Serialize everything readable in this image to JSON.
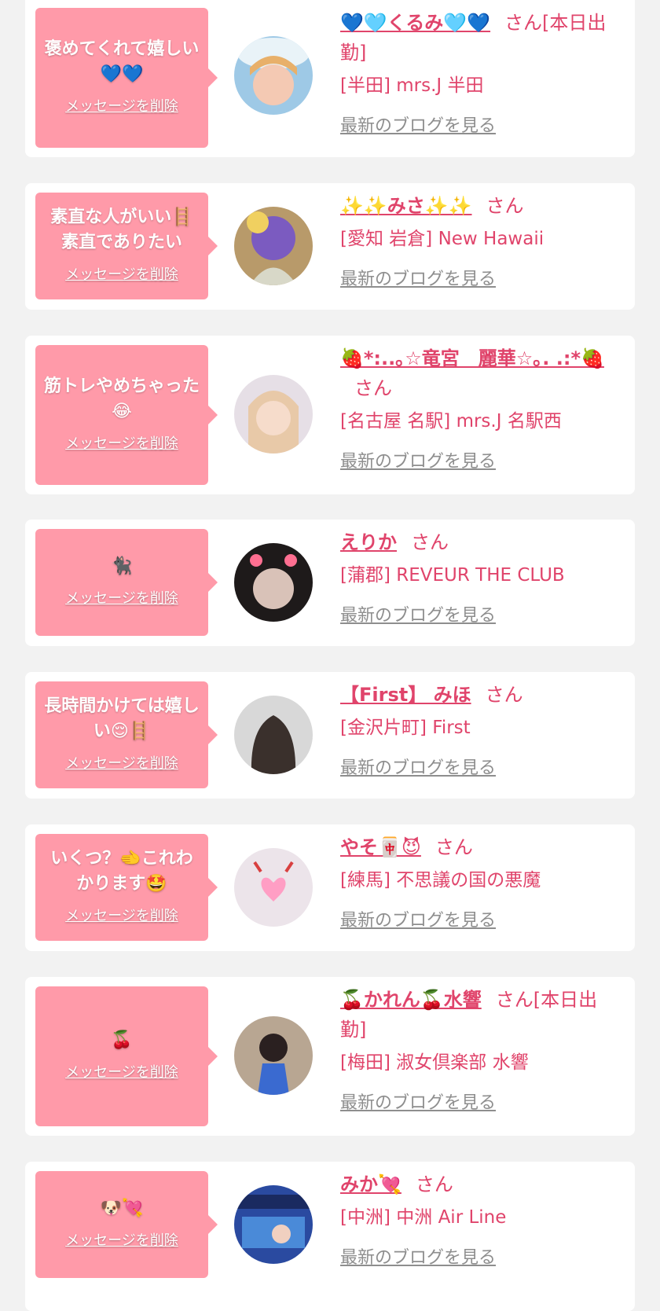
{
  "favorites": [
    {
      "message": "褒めてくれて嬉しい💙💙",
      "delete_label": "メッセージを削除",
      "name": "💙🩵くるみ🩵💙",
      "honorific": "さん[本日出勤]",
      "shop": "[半田] mrs.J 半田",
      "blog_label": "最新のブログを見る"
    },
    {
      "message": "素直な人がいい🪜素直でありたい",
      "delete_label": "メッセージを削除",
      "name": "✨✨みさ✨✨",
      "honorific": "さん",
      "shop": "[愛知 岩倉] New Hawaii",
      "blog_label": "最新のブログを見る"
    },
    {
      "message": "筋トレやめちゃった😂",
      "delete_label": "メッセージを削除",
      "name": "🍓*:..｡☆竜宮　麗華☆｡. .:*🍓",
      "honorific": "さん",
      "shop": "[名古屋 名駅] mrs.J 名駅西",
      "blog_label": "最新のブログを見る"
    },
    {
      "message": "🐈‍⬛",
      "delete_label": "メッセージを削除",
      "name": "えりか",
      "honorific": "さん",
      "shop": "[蒲郡] REVEUR THE CLUB",
      "blog_label": "最新のブログを見る"
    },
    {
      "message": "長時間かけては嬉しい😌🪜",
      "delete_label": "メッセージを削除",
      "name": "【First】 みほ",
      "honorific": "さん",
      "shop": "[金沢片町] First",
      "blog_label": "最新のブログを見る"
    },
    {
      "message": "いくつ？🫲これわかります🤩",
      "delete_label": "メッセージを削除",
      "name": "やそ🀄😈",
      "honorific": "さん",
      "shop": "[練馬] 不思議の国の悪魔",
      "blog_label": "最新のブログを見る"
    },
    {
      "message": "🍒",
      "delete_label": "メッセージを削除",
      "name": "🍒かれん🍒水響",
      "honorific": "さん[本日出勤]",
      "shop": "[梅田] 淑女倶楽部 水響",
      "blog_label": "最新のブログを見る"
    },
    {
      "message": "🐶💘",
      "delete_label": "メッセージを削除",
      "name": "みか💘",
      "honorific": "さん",
      "shop": "[中洲] 中洲 Air Line",
      "blog_label": "最新のブログを見る"
    }
  ]
}
